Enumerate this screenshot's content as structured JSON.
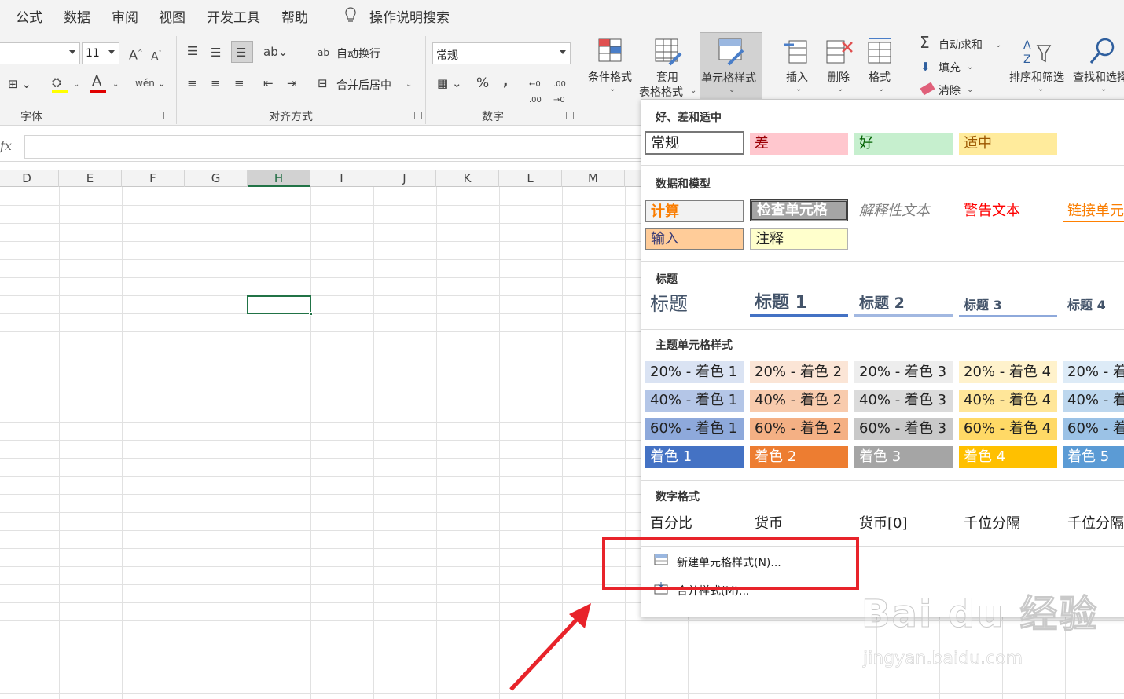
{
  "menubar": {
    "items": [
      "公式",
      "数据",
      "审阅",
      "视图",
      "开发工具",
      "帮助"
    ],
    "search_label": "操作说明搜索"
  },
  "ribbon": {
    "font_size": "11",
    "wrap_label": "自动换行",
    "merge_label": "合并后居中",
    "number_format": "常规",
    "percent": "%",
    "comma": ",",
    "group_font": "字体",
    "group_align": "对齐方式",
    "group_number": "数字",
    "cond_format": "条件格式",
    "table_format_1": "套用",
    "table_format_2": "表格格式",
    "cell_style": "单元格样式",
    "insert": "插入",
    "delete": "删除",
    "format": "格式",
    "autosum": "自动求和",
    "fill": "填充",
    "clear": "清除",
    "sort_filter": "排序和筛选",
    "find_select": "查找和选择"
  },
  "formula_bar": {
    "fx": "fx"
  },
  "columns": [
    "D",
    "E",
    "F",
    "G",
    "H",
    "I",
    "J",
    "K",
    "L",
    "M"
  ],
  "dropdown": {
    "sec1_title": "好、差和适中",
    "sec1": [
      "常规",
      "差",
      "好",
      "适中"
    ],
    "sec2_title": "数据和模型",
    "sec2": [
      "计算",
      "检查单元格",
      "解释性文本",
      "警告文本",
      "链接单元",
      "输入",
      "注释"
    ],
    "sec3_title": "标题",
    "sec3": [
      "标题",
      "标题 1",
      "标题 2",
      "标题 3",
      "标题 4"
    ],
    "sec4_title": "主题单元格样式",
    "sec4": [
      [
        "20% - 着色 1",
        "20% - 着色 2",
        "20% - 着色 3",
        "20% - 着色 4",
        "20% - 着"
      ],
      [
        "40% - 着色 1",
        "40% - 着色 2",
        "40% - 着色 3",
        "40% - 着色 4",
        "40% - 着"
      ],
      [
        "60% - 着色 1",
        "60% - 着色 2",
        "60% - 着色 3",
        "60% - 着色 4",
        "60% - 着"
      ],
      [
        "着色 1",
        "着色 2",
        "着色 3",
        "着色 4",
        "着色 5"
      ]
    ],
    "sec5_title": "数字格式",
    "sec5": [
      "百分比",
      "货币",
      "货币[0]",
      "千位分隔",
      "千位分隔"
    ],
    "new_style": "新建单元格样式(N)...",
    "merge_styles": "合并样式(M)..."
  },
  "watermark": {
    "brand": "Bai du 经验",
    "url": "jingyan.baidu.com"
  },
  "colors": {
    "highlight": "#e8232a",
    "selected_cell": "#217346"
  }
}
